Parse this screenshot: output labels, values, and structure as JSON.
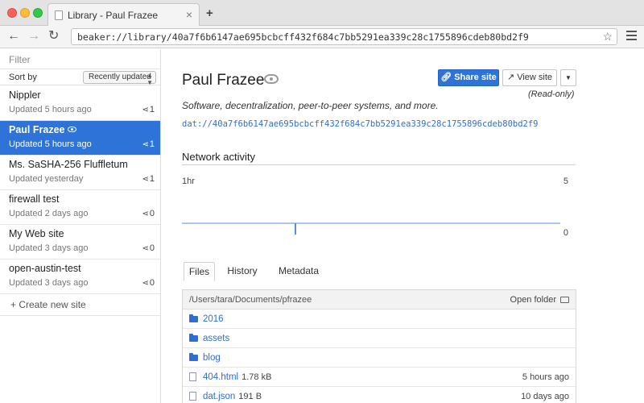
{
  "browser": {
    "tab_title": "Library - Paul Frazee",
    "tab_close": "×",
    "new_tab": "+",
    "url": "beaker://library/40a7f6b6147ae695bcbcff432f684c7bb5291ea339c28c1755896cdeb80bd2f9",
    "icons": {
      "back": "←",
      "forward": "→",
      "reload": "↻",
      "star": "☆"
    }
  },
  "sidebar": {
    "filter_placeholder": "Filter",
    "sort_label": "Sort by",
    "sort_value": "Recently updated",
    "sites": [
      {
        "name": "Nippler",
        "updated": "Updated 5 hours ago",
        "peers": "1",
        "active": false
      },
      {
        "name": "Paul Frazee",
        "updated": "Updated 5 hours ago",
        "peers": "1",
        "active": true
      },
      {
        "name": "Ms. SaSHA-256 Fluffletum",
        "updated": "Updated yesterday",
        "peers": "1",
        "active": false
      },
      {
        "name": "firewall test",
        "updated": "Updated 2 days ago",
        "peers": "0",
        "active": false
      },
      {
        "name": "My Web site",
        "updated": "Updated 3 days ago",
        "peers": "0",
        "active": false
      },
      {
        "name": "open-austin-test",
        "updated": "Updated 3 days ago",
        "peers": "0",
        "active": false
      }
    ],
    "create_label": "+ Create new site"
  },
  "main": {
    "title": "Paul Frazee",
    "share_button": "Share site",
    "view_button": "View site",
    "dropdown_glyph": "▼",
    "readonly": "(Read-only)",
    "description": "Software, decentralization, peer-to-peer systems, and more.",
    "dat_url": "dat://40a7f6b6147ae695bcbcff432f684c7bb5291ea339c28c1755896cdeb80bd2f9",
    "network_title": "Network activity",
    "tabs": [
      "Files",
      "History",
      "Metadata"
    ],
    "files": {
      "path": "/Users/tara/Documents/pfrazee",
      "open_folder": "Open folder",
      "rows": [
        {
          "name": "2016",
          "type": "folder",
          "size": "",
          "date": ""
        },
        {
          "name": "assets",
          "type": "folder",
          "size": "",
          "date": ""
        },
        {
          "name": "blog",
          "type": "folder",
          "size": "",
          "date": ""
        },
        {
          "name": "404.html",
          "type": "file",
          "size": "1.78 kB",
          "date": "5 hours ago"
        },
        {
          "name": "dat.json",
          "type": "file",
          "size": "191 B",
          "date": "10 days ago"
        }
      ]
    }
  },
  "chart_data": {
    "type": "line",
    "xlabel": "1hr",
    "ylim": [
      0,
      5
    ],
    "tick_labels": {
      "y_max": "5",
      "y_min": "0"
    },
    "series": [
      {
        "values": [
          0,
          0,
          0,
          0,
          0,
          0,
          0,
          0,
          0,
          0,
          0,
          0,
          0,
          0,
          0,
          0,
          0,
          0,
          0,
          0,
          0,
          0,
          0,
          0,
          0,
          0,
          0,
          0,
          0,
          0,
          0,
          0,
          0,
          0,
          0,
          0,
          0,
          0,
          0,
          0,
          0,
          0,
          0,
          0,
          0,
          0,
          0,
          0,
          0,
          0,
          0,
          0,
          0,
          0,
          0,
          0,
          0,
          0,
          0,
          0,
          0
        ]
      }
    ],
    "spike_index": 18,
    "color": "#5a8fd9"
  }
}
